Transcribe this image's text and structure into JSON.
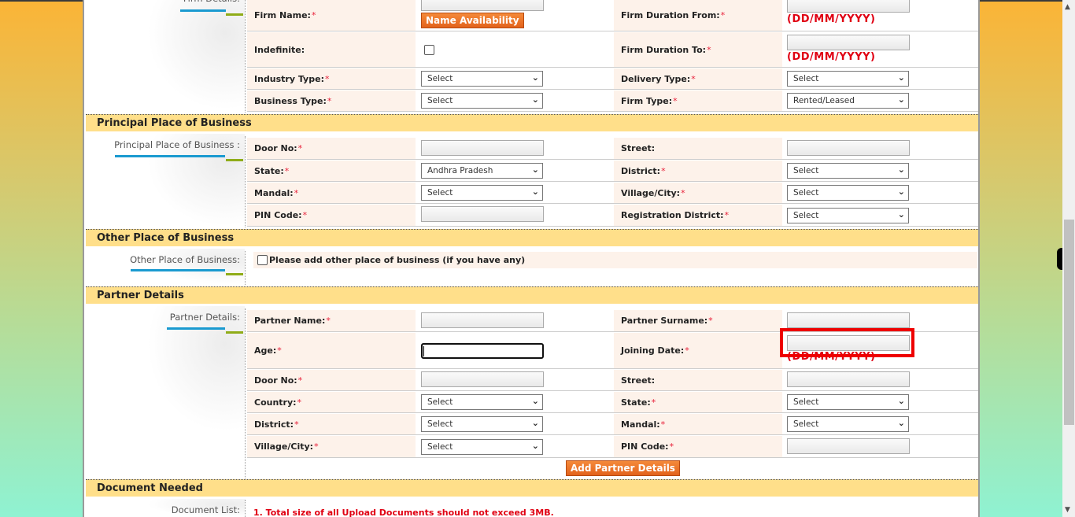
{
  "firm_details": {
    "side_label": "Firm Details:",
    "fields": {
      "firm_name": {
        "label": "Firm Name:",
        "required": "*",
        "value": ""
      },
      "name_availability_button": "Name Availability",
      "firm_duration_from": {
        "label": "Firm Duration From:",
        "required": "*",
        "value": "",
        "hint": "(DD/MM/YYYY)"
      },
      "indefinite": {
        "label": "Indefinite:",
        "checked": false
      },
      "firm_duration_to": {
        "label": "Firm Duration To:",
        "required": "*",
        "value": "",
        "hint": "(DD/MM/YYYY)"
      },
      "industry_type": {
        "label": "Industry Type:",
        "required": "*",
        "selected": "Select"
      },
      "delivery_type": {
        "label": "Delivery Type:",
        "required": "*",
        "selected": "Select"
      },
      "business_type": {
        "label": "Business Type:",
        "required": "*",
        "selected": "Select"
      },
      "firm_type": {
        "label": "Firm Type:",
        "required": "*",
        "selected": "Rented/Leased"
      }
    }
  },
  "principal_place": {
    "title": "Principal Place of Business",
    "side_label": "Principal Place of Business :",
    "fields": {
      "door_no": {
        "label": "Door No:",
        "required": "*",
        "value": ""
      },
      "street": {
        "label": "Street:",
        "value": ""
      },
      "state": {
        "label": "State:",
        "required": "*",
        "selected": "Andhra Pradesh"
      },
      "district": {
        "label": "District:",
        "required": "*",
        "selected": "Select"
      },
      "mandal": {
        "label": "Mandal:",
        "required": "*",
        "selected": "Select"
      },
      "village_city": {
        "label": "Village/City:",
        "required": "*",
        "selected": "Select"
      },
      "pin_code": {
        "label": "PIN Code:",
        "required": "*",
        "value": ""
      },
      "registration_district": {
        "label": "Registration District:",
        "required": "*",
        "selected": "Select"
      }
    }
  },
  "other_place": {
    "title": "Other Place of Business",
    "side_label": "Other Place of Business:",
    "checkbox_label": "Please add other place of business (if you have any)",
    "checked": false
  },
  "partner_details": {
    "title": "Partner Details",
    "side_label": "Partner Details:",
    "fields": {
      "partner_name": {
        "label": "Partner Name:",
        "required": "*",
        "value": ""
      },
      "partner_surname": {
        "label": "Partner Surname:",
        "required": "*",
        "value": ""
      },
      "age": {
        "label": "Age:",
        "required": "*",
        "value": ""
      },
      "joining_date": {
        "label": "Joining Date:",
        "required": "*",
        "value": "",
        "hint": "(DD/MM/YYYY)"
      },
      "door_no": {
        "label": "Door No:",
        "required": "*",
        "value": ""
      },
      "street": {
        "label": "Street:",
        "value": ""
      },
      "country": {
        "label": "Country:",
        "required": "*",
        "selected": "Select"
      },
      "state": {
        "label": "State:",
        "required": "*",
        "selected": "Select"
      },
      "district": {
        "label": "District:",
        "required": "*",
        "selected": "Select"
      },
      "mandal": {
        "label": "Mandal:",
        "required": "*",
        "selected": "Select"
      },
      "village_city": {
        "label": "Village/City:",
        "required": "*",
        "selected": "Select"
      },
      "pin_code": {
        "label": "PIN Code:",
        "required": "*",
        "value": ""
      }
    },
    "add_button": "Add Partner Details"
  },
  "documents": {
    "title": "Document Needed",
    "side_label": "Document List:",
    "notes": [
      "1. Total size of all Upload Documents should not exceed 3MB."
    ]
  },
  "icons": {
    "chevron": "⌵",
    "scroll_up": "▲",
    "scroll_down": "▼"
  },
  "colors": {
    "section_header_bg": "#ffdf8a",
    "label_bg": "#fdf2ea",
    "required_star": "#e8203a",
    "button_orange": "#e2621c",
    "highlight_red": "#ee0000",
    "hint_red": "#e00012"
  }
}
